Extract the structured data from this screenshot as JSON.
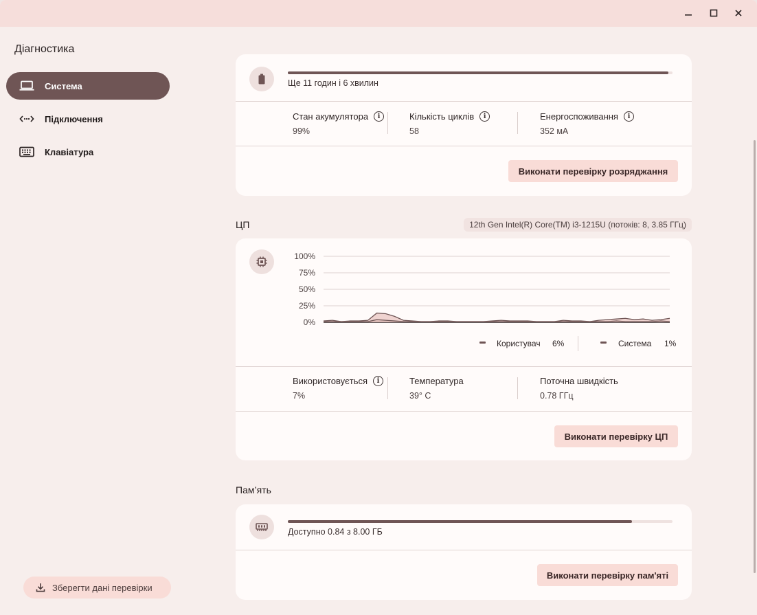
{
  "app": {
    "title": "Діагностика"
  },
  "titlebar": {
    "minimize_icon": "minimize-icon",
    "maximize_icon": "maximize-icon",
    "close_icon": "close-icon"
  },
  "sidebar": {
    "items": [
      {
        "label": "Система",
        "icon": "laptop-icon",
        "active": true
      },
      {
        "label": "Підключення",
        "icon": "connectivity-icon",
        "active": false
      },
      {
        "label": "Клавіатура",
        "icon": "keyboard-icon",
        "active": false
      }
    ],
    "save_button": {
      "label": "Зберегти дані перевірки",
      "icon": "download-icon"
    }
  },
  "battery": {
    "icon": "battery-icon",
    "charge_fraction": 0.99,
    "time_remaining": "Ще 11 годин і 6 хвилин",
    "stats": [
      {
        "label": "Стан акумулятора",
        "value": "99%",
        "info": true
      },
      {
        "label": "Кількість циклів",
        "value": "58",
        "info": true
      },
      {
        "label": "Енергоспоживання",
        "value": "352 мА",
        "info": true
      }
    ],
    "test_button": "Виконати перевірку розряджання"
  },
  "cpu": {
    "section_title": "ЦП",
    "chip": "12th Gen Intel(R) Core(TM) i3-1215U (потоків: 8, 3.85 ГГц)",
    "icon": "cpu-icon",
    "chart_data": {
      "type": "area",
      "y_ticks": [
        "100%",
        "75%",
        "50%",
        "25%",
        "0%"
      ],
      "ylim": [
        0,
        100
      ],
      "grid": true,
      "series": [
        {
          "name": "Користувач",
          "current": "6%",
          "values": [
            2,
            3,
            1,
            2,
            2,
            3,
            14,
            13,
            9,
            3,
            2,
            1,
            1,
            2,
            2,
            1,
            1,
            1,
            1,
            2,
            3,
            2,
            2,
            2,
            1,
            1,
            1,
            3,
            2,
            2,
            1,
            3,
            4,
            5,
            6,
            4,
            5,
            3,
            4,
            6
          ]
        },
        {
          "name": "Система",
          "current": "1%",
          "values": [
            1,
            1,
            1,
            1,
            1,
            1,
            4,
            3,
            2,
            1,
            1,
            1,
            1,
            1,
            1,
            1,
            1,
            1,
            1,
            1,
            1,
            1,
            1,
            1,
            1,
            1,
            1,
            1,
            1,
            1,
            1,
            1,
            1,
            2,
            1,
            1,
            1,
            1,
            2,
            1
          ]
        }
      ],
      "legend_position": "bottom-right"
    },
    "stats": [
      {
        "label": "Використовується",
        "value": "7%",
        "info": true
      },
      {
        "label": "Температура",
        "value": "39° C",
        "info": false
      },
      {
        "label": "Поточна швидкість",
        "value": "0.78 ГГц",
        "info": false
      }
    ],
    "test_button": "Виконати перевірку ЦП"
  },
  "memory": {
    "section_title": "Пам’ять",
    "icon": "memory-icon",
    "used_fraction": 0.895,
    "available_text": "Доступно 0.84 з 8.00 ГБ",
    "test_button": "Виконати перевірку пам'яті"
  },
  "colors": {
    "accent": "#6f5555",
    "button_bg": "#f9dcd7",
    "card_bg": "#fffbfa",
    "window_bg": "#f7eeec",
    "titlebar_bg": "#f6dedb"
  }
}
